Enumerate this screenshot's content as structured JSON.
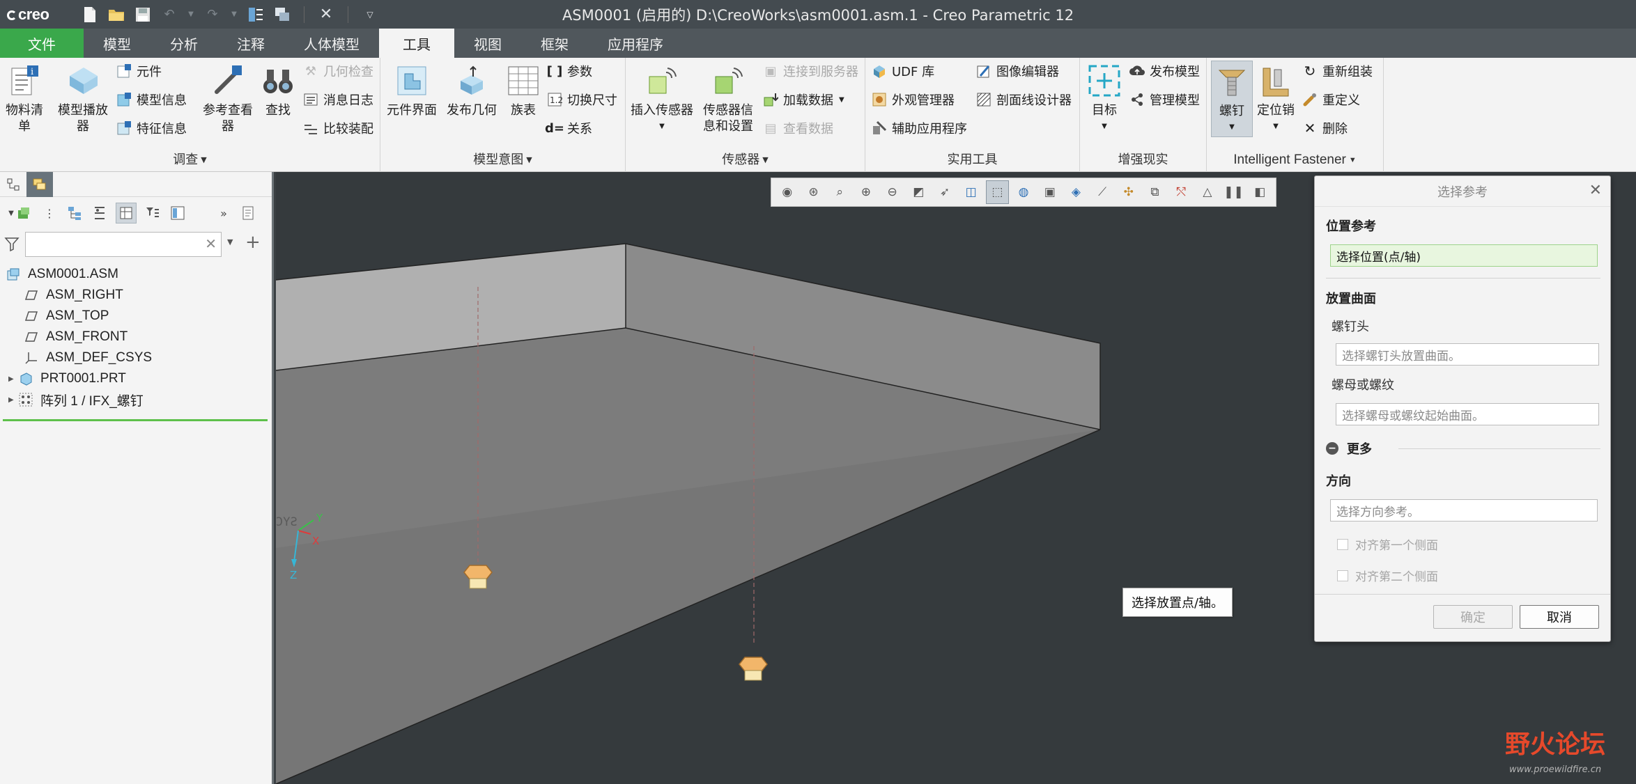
{
  "app": {
    "logo": "creo",
    "window_title": "ASM0001 (启用的) D:\\CreoWorks\\asm0001.asm.1 - Creo Parametric 12"
  },
  "tabs": [
    {
      "label": "文件"
    },
    {
      "label": "模型"
    },
    {
      "label": "分析"
    },
    {
      "label": "注释"
    },
    {
      "label": "人体模型"
    },
    {
      "label": "工具"
    },
    {
      "label": "视图"
    },
    {
      "label": "框架"
    },
    {
      "label": "应用程序"
    }
  ],
  "ribbon": {
    "investigate": {
      "label": "调查",
      "bom": "物料清单",
      "model_player_1": "模型播放",
      "model_player_2": "器",
      "component": "元件",
      "model_info": "模型信息",
      "feature_info": "特征信息",
      "ref_viewer_1": "参考查看",
      "ref_viewer_2": "器",
      "find": "查找",
      "geom_check": "几何检查",
      "message_log": "消息日志",
      "compare": "比较装配"
    },
    "model_intent": {
      "label": "模型意图",
      "comp_interface": "元件界面",
      "publish_geom": "发布几何",
      "family_table": "族表",
      "parameters": "参数",
      "switch_dims": "切换尺寸",
      "relations": "关系"
    },
    "sensors": {
      "label": "传感器",
      "insert_sensor": "插入传感器",
      "sensor_info_1": "传感器信",
      "sensor_info_2": "息和设置",
      "connect_server": "连接到服务器",
      "load_data": "加载数据",
      "view_data": "查看数据"
    },
    "utilities": {
      "label": "实用工具",
      "udf_lib": "UDF 库",
      "appearance_mgr": "外观管理器",
      "aux_apps": "辅助应用程序",
      "image_editor": "图像编辑器",
      "xsec_designer": "剖面线设计器"
    },
    "ar": {
      "label": "增强现实",
      "target": "目标",
      "publish_model": "发布模型",
      "manage_model": "管理模型"
    },
    "fastener": {
      "label": "Intelligent Fastener",
      "screw": "螺钉",
      "dowel": "定位销",
      "reassemble": "重新组装",
      "redefine": "重定义",
      "delete": "删除"
    }
  },
  "tree": {
    "nodes": [
      {
        "label": "ASM0001.ASM"
      },
      {
        "label": "ASM_RIGHT"
      },
      {
        "label": "ASM_TOP"
      },
      {
        "label": "ASM_FRONT"
      },
      {
        "label": "ASM_DEF_CSYS"
      },
      {
        "label": "PRT0001.PRT"
      },
      {
        "label": "阵列 1 / IFX_螺钉"
      }
    ]
  },
  "viewport": {
    "tooltip": "选择放置点/轴。",
    "csys_label": "ƆYƧ",
    "axis_x": "X",
    "axis_y": "Y",
    "axis_z": "Z"
  },
  "dialog": {
    "title": "选择参考",
    "position_ref": "位置参考",
    "position_field": "选择位置(点/轴)",
    "placement_surface": "放置曲面",
    "screw_head": "螺钉头",
    "screw_head_placeholder": "选择螺钉头放置曲面。",
    "nut_or_thread": "螺母或螺纹",
    "nut_placeholder": "选择螺母或螺纹起始曲面。",
    "more": "更多",
    "direction": "方向",
    "direction_placeholder": "选择方向参考。",
    "align_first": "对齐第一个侧面",
    "align_second": "对齐第二个侧面",
    "ok": "确定",
    "cancel": "取消"
  },
  "watermark": {
    "text": "野火论坛",
    "url": "www.proewildfire.cn"
  },
  "colors": {
    "file_tab": "#3aa84b",
    "title_bar": "#444b50",
    "viewport_bg": "#353a3d",
    "active_field": "#e8f6df"
  }
}
